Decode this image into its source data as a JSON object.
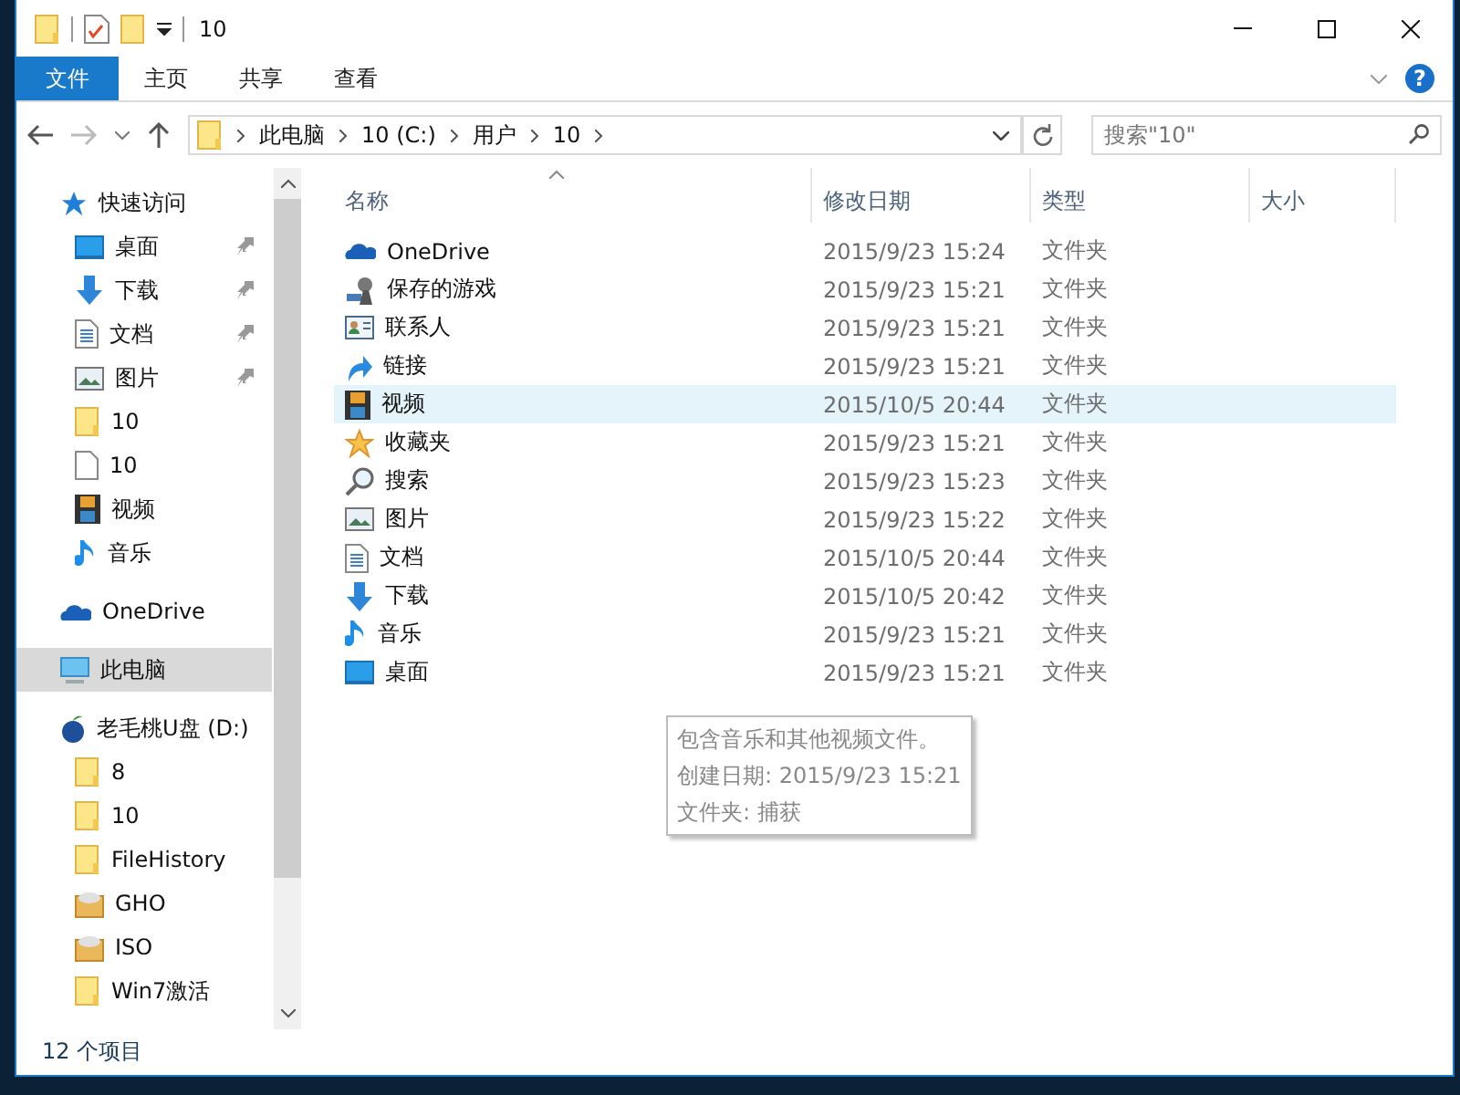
{
  "window": {
    "title": "10"
  },
  "ribbon": {
    "tabs": [
      {
        "label": "文件",
        "selected": true
      },
      {
        "label": "主页",
        "selected": false
      },
      {
        "label": "共享",
        "selected": false
      },
      {
        "label": "查看",
        "selected": false
      }
    ],
    "help": "?"
  },
  "address": {
    "path": [
      "此电脑",
      "10 (C:)",
      "用户",
      "10"
    ]
  },
  "search": {
    "placeholder": "搜索\"10\""
  },
  "sidebar": {
    "items": [
      {
        "label": "快速访问",
        "kind": "quick",
        "selected": false,
        "children": [
          {
            "label": "桌面",
            "kind": "desktop",
            "pinned": true,
            "selected": false
          },
          {
            "label": "下载",
            "kind": "download",
            "pinned": true,
            "selected": false
          },
          {
            "label": "文档",
            "kind": "doc",
            "pinned": true,
            "selected": false
          },
          {
            "label": "图片",
            "kind": "pictures",
            "pinned": true,
            "selected": false
          },
          {
            "label": "10",
            "kind": "folder",
            "pinned": false,
            "selected": false
          },
          {
            "label": "10",
            "kind": "file",
            "pinned": false,
            "selected": false
          },
          {
            "label": "视频",
            "kind": "video",
            "pinned": false,
            "selected": false
          },
          {
            "label": "音乐",
            "kind": "music",
            "pinned": false,
            "selected": false
          }
        ]
      },
      {
        "label": "OneDrive",
        "kind": "onedrive",
        "selected": false
      },
      {
        "label": "此电脑",
        "kind": "pc",
        "selected": true
      },
      {
        "label": "老毛桃U盘 (D:)",
        "kind": "drive",
        "selected": false,
        "children": [
          {
            "label": "8",
            "kind": "folder",
            "selected": false
          },
          {
            "label": "10",
            "kind": "folder",
            "selected": false
          },
          {
            "label": "FileHistory",
            "kind": "folder",
            "selected": false
          },
          {
            "label": "GHO",
            "kind": "disc",
            "selected": false
          },
          {
            "label": "ISO",
            "kind": "disc",
            "selected": false
          },
          {
            "label": "Win7激活",
            "kind": "folder",
            "selected": false
          }
        ]
      }
    ]
  },
  "table": {
    "columns": [
      {
        "label": "名称",
        "sorted": true
      },
      {
        "label": "修改日期",
        "sorted": false
      },
      {
        "label": "类型",
        "sorted": false
      },
      {
        "label": "大小",
        "sorted": false
      }
    ],
    "rows": [
      {
        "name": "OneDrive",
        "kind": "onedrive",
        "date": "2015/9/23 15:24",
        "type": "文件夹",
        "hovered": false
      },
      {
        "name": "保存的游戏",
        "kind": "games",
        "date": "2015/9/23 15:21",
        "type": "文件夹",
        "hovered": false
      },
      {
        "name": "联系人",
        "kind": "contacts",
        "date": "2015/9/23 15:21",
        "type": "文件夹",
        "hovered": false
      },
      {
        "name": "链接",
        "kind": "link",
        "date": "2015/9/23 15:21",
        "type": "文件夹",
        "hovered": false
      },
      {
        "name": "视频",
        "kind": "video",
        "date": "2015/10/5 20:44",
        "type": "文件夹",
        "hovered": true
      },
      {
        "name": "收藏夹",
        "kind": "star",
        "date": "2015/9/23 15:21",
        "type": "文件夹",
        "hovered": false
      },
      {
        "name": "搜索",
        "kind": "search",
        "date": "2015/9/23 15:23",
        "type": "文件夹",
        "hovered": false
      },
      {
        "name": "图片",
        "kind": "pictures",
        "date": "2015/9/23 15:22",
        "type": "文件夹",
        "hovered": false
      },
      {
        "name": "文档",
        "kind": "doc",
        "date": "2015/10/5 20:44",
        "type": "文件夹",
        "hovered": false
      },
      {
        "name": "下载",
        "kind": "download",
        "date": "2015/10/5 20:42",
        "type": "文件夹",
        "hovered": false
      },
      {
        "name": "音乐",
        "kind": "music",
        "date": "2015/9/23 15:21",
        "type": "文件夹",
        "hovered": false
      },
      {
        "name": "桌面",
        "kind": "desktop",
        "date": "2015/9/23 15:21",
        "type": "文件夹",
        "hovered": false
      }
    ]
  },
  "tooltip": {
    "lines": [
      "包含音乐和其他视频文件。",
      "创建日期: 2015/9/23 15:21",
      "文件夹: 捕获"
    ]
  },
  "status_bar": {
    "count": "12 个项目"
  }
}
